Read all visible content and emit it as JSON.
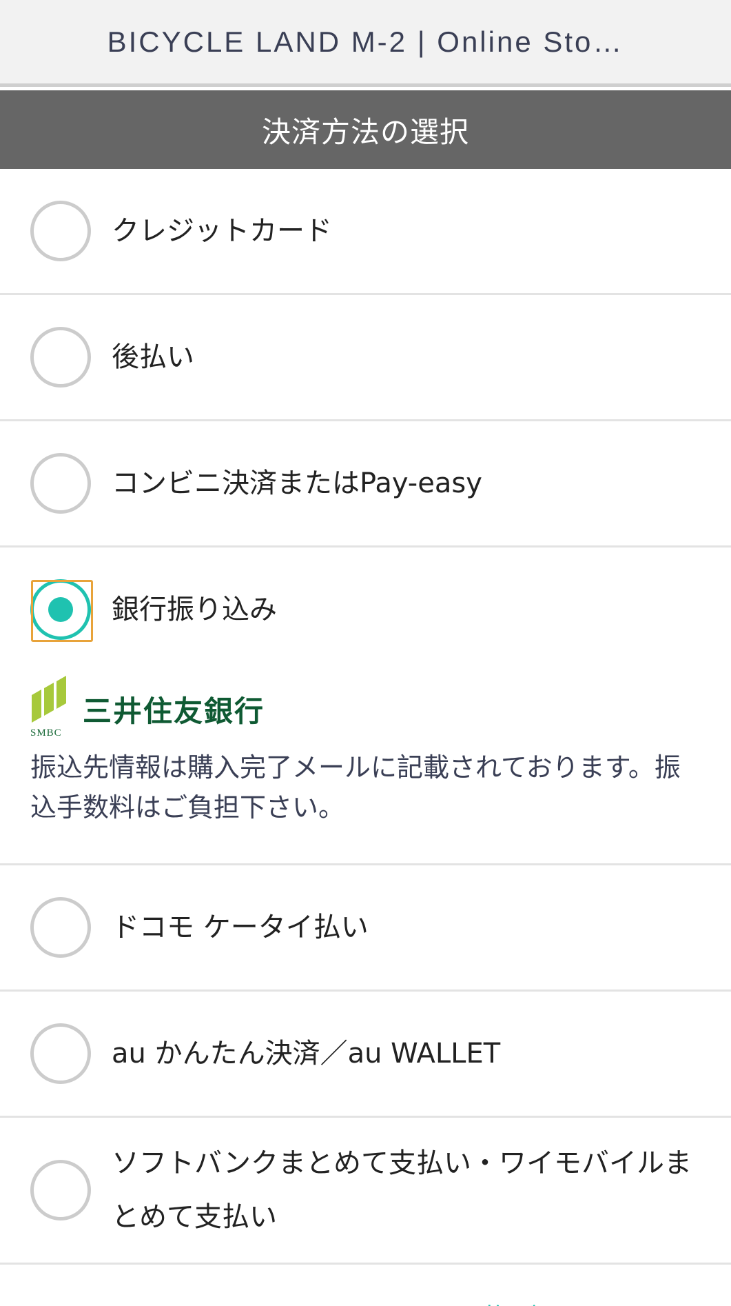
{
  "header": {
    "title": "BICYCLE LAND M-2 | Online Sto…"
  },
  "section": {
    "title": "決済方法の選択"
  },
  "payment_options": [
    {
      "label": "クレジットカード",
      "selected": false
    },
    {
      "label": "後払い",
      "selected": false
    },
    {
      "label": "コンビニ決済またはPay-easy",
      "selected": false
    },
    {
      "label": "銀行振り込み",
      "selected": true
    },
    {
      "label": "ドコモ ケータイ払い",
      "selected": false
    },
    {
      "label": "au かんたん決済／au WALLET",
      "selected": false
    },
    {
      "label": "ソフトバンクまとめて支払い・ワイモバイルまとめて支払い",
      "selected": false
    }
  ],
  "bank_transfer": {
    "logo_mark_text": "SMBC",
    "bank_name": "三井住友銀行",
    "note": "振込先情報は購入完了メールに記載されております。振込手数料はご負担下さい。"
  },
  "colors": {
    "accent": "#1fc2b0",
    "focus": "#e8a33a",
    "section_header_bg": "#666666",
    "bank_green": "#0f5a33"
  },
  "footer": {
    "partial_link_text": "ペ…を買い物が…"
  }
}
